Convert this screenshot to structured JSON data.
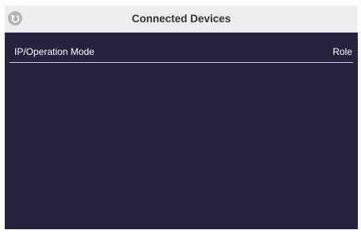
{
  "header": {
    "title": "Connected Devices",
    "back_icon": "back-arrow-icon"
  },
  "table": {
    "columns": [
      "IP/Operation Mode",
      "Role"
    ],
    "rows": []
  },
  "colors": {
    "background": "#272240",
    "header_bar": "#ededed",
    "text_light": "#ffffff"
  }
}
